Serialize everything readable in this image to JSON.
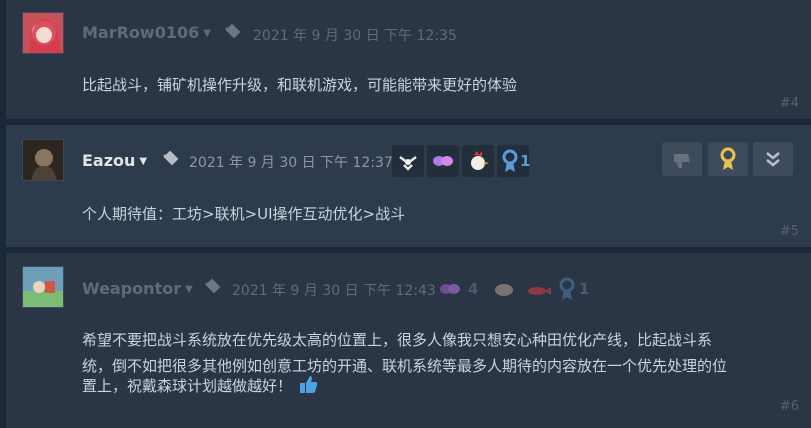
{
  "comments": [
    {
      "author": "MarRow0106",
      "timestamp": "2021 年 9 月 30 日 下午 12:35",
      "text": "比起战斗，铺矿机操作升级，和联机游戏，可能能带来更好的体验",
      "number": "#4"
    },
    {
      "author": "Eazou",
      "timestamp": "2021 年 9 月 30 日 下午 12:37",
      "text": "个人期待值：工坊>联机>UI操作互动优化>战斗",
      "number": "#5",
      "award_count": "1",
      "badge_icons": [
        "bird-icon",
        "pink-butterfly-icon",
        "rooster-icon",
        "award-ribbon-icon"
      ],
      "controls": [
        "thumb-down-icon",
        "award-icon",
        "chevron-double-down-icon"
      ]
    },
    {
      "author": "Weapontor",
      "timestamp": "2021 年 9 月 30 日 下午 12:43",
      "text_line1": "希望不要把战斗系统放在优先级太高的位置上，很多人像我只想安心种田优化产线，比起战斗系",
      "text_line2": "统，倒不如把很多其他例如创意工坊的开通、联机系统等最多人期待的内容放在一个优先处理的位",
      "text_line3": "置上，祝戴森球计划越做越好！",
      "number": "#6",
      "reaction_count": "4",
      "award_count": "1",
      "badge_icons": [
        "butterfly-icon",
        "shell-icon",
        "fish-icon",
        "award-ribbon-icon"
      ]
    }
  ],
  "colors": {
    "background": "#1b2838",
    "card": "#2a3646",
    "accent_blue": "#5a9bd8",
    "gold": "#e8c24a"
  }
}
